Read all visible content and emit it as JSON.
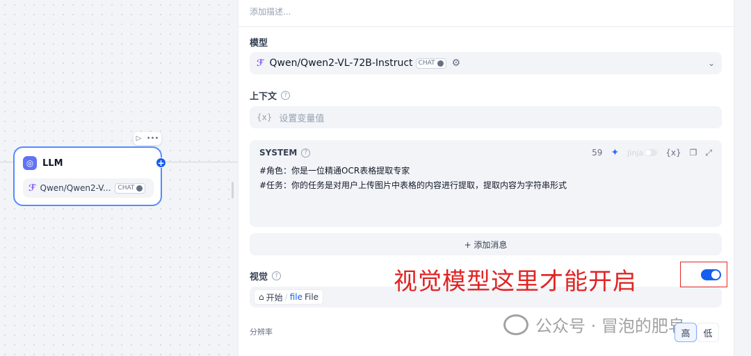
{
  "canvas": {
    "node_title": "LLM",
    "node_model": "Qwen/Qwen2-V...",
    "chat_badge": "CHAT"
  },
  "panel": {
    "description_placeholder": "添加描述...",
    "model_label": "模型",
    "model_name": "Qwen/Qwen2-VL-72B-Instruct",
    "model_badge": "CHAT",
    "context_label": "上下文",
    "context_var_icon": "{x}",
    "context_placeholder": "设置变量值",
    "system": {
      "title": "SYSTEM",
      "token_count": "59",
      "jinja_label": "Jinja",
      "var_button": "{x}",
      "lines": [
        "#角色：你是一位精通OCR表格提取专家",
        "#任务：你的任务是对用户上传图片中表格的内容进行提取，提取内容为字符串形式"
      ]
    },
    "add_message": "+ 添加消息",
    "vision_label": "视觉",
    "vision_enabled": true,
    "file_chip": {
      "source": "开始",
      "separator": "/",
      "var_name": "file",
      "type": "File"
    },
    "resolution_label": "分辨率",
    "resolution_options": [
      "高",
      "低"
    ]
  },
  "annotation": "视觉模型这里才能开启",
  "watermark": "公众号 · 冒泡的肥皂",
  "colors": {
    "accent": "#155eef",
    "annotation": "#e02424"
  }
}
